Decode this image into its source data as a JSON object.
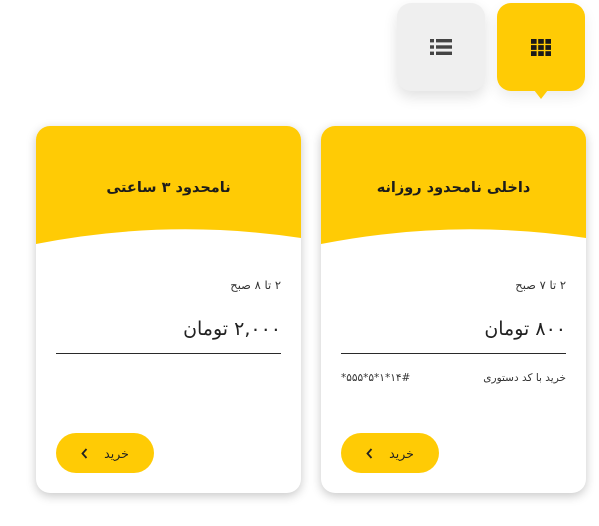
{
  "view_toggle": {
    "list_icon": "list-icon",
    "grid_icon": "grid-icon",
    "active": "grid"
  },
  "colors": {
    "accent": "#ffcb05",
    "card_bg": "#ffffff",
    "toggle_inactive": "#efefef"
  },
  "plans": [
    {
      "title": "داخلی نامحدود روزانه",
      "time": "۲ تا ۷ صبح",
      "price": "۸۰۰ تومان",
      "code_label": "خرید با کد دستوری",
      "code": "*۵۵۵*۵*۱*۱۴#",
      "buy_label": "خرید",
      "buy_icon": "chevron-left-icon"
    },
    {
      "title": "نامحدود ۳ ساعتی",
      "time": "۲ تا ۸ صبح",
      "price": "۲,۰۰۰ تومان",
      "buy_label": "خرید",
      "buy_icon": "chevron-left-icon"
    }
  ]
}
